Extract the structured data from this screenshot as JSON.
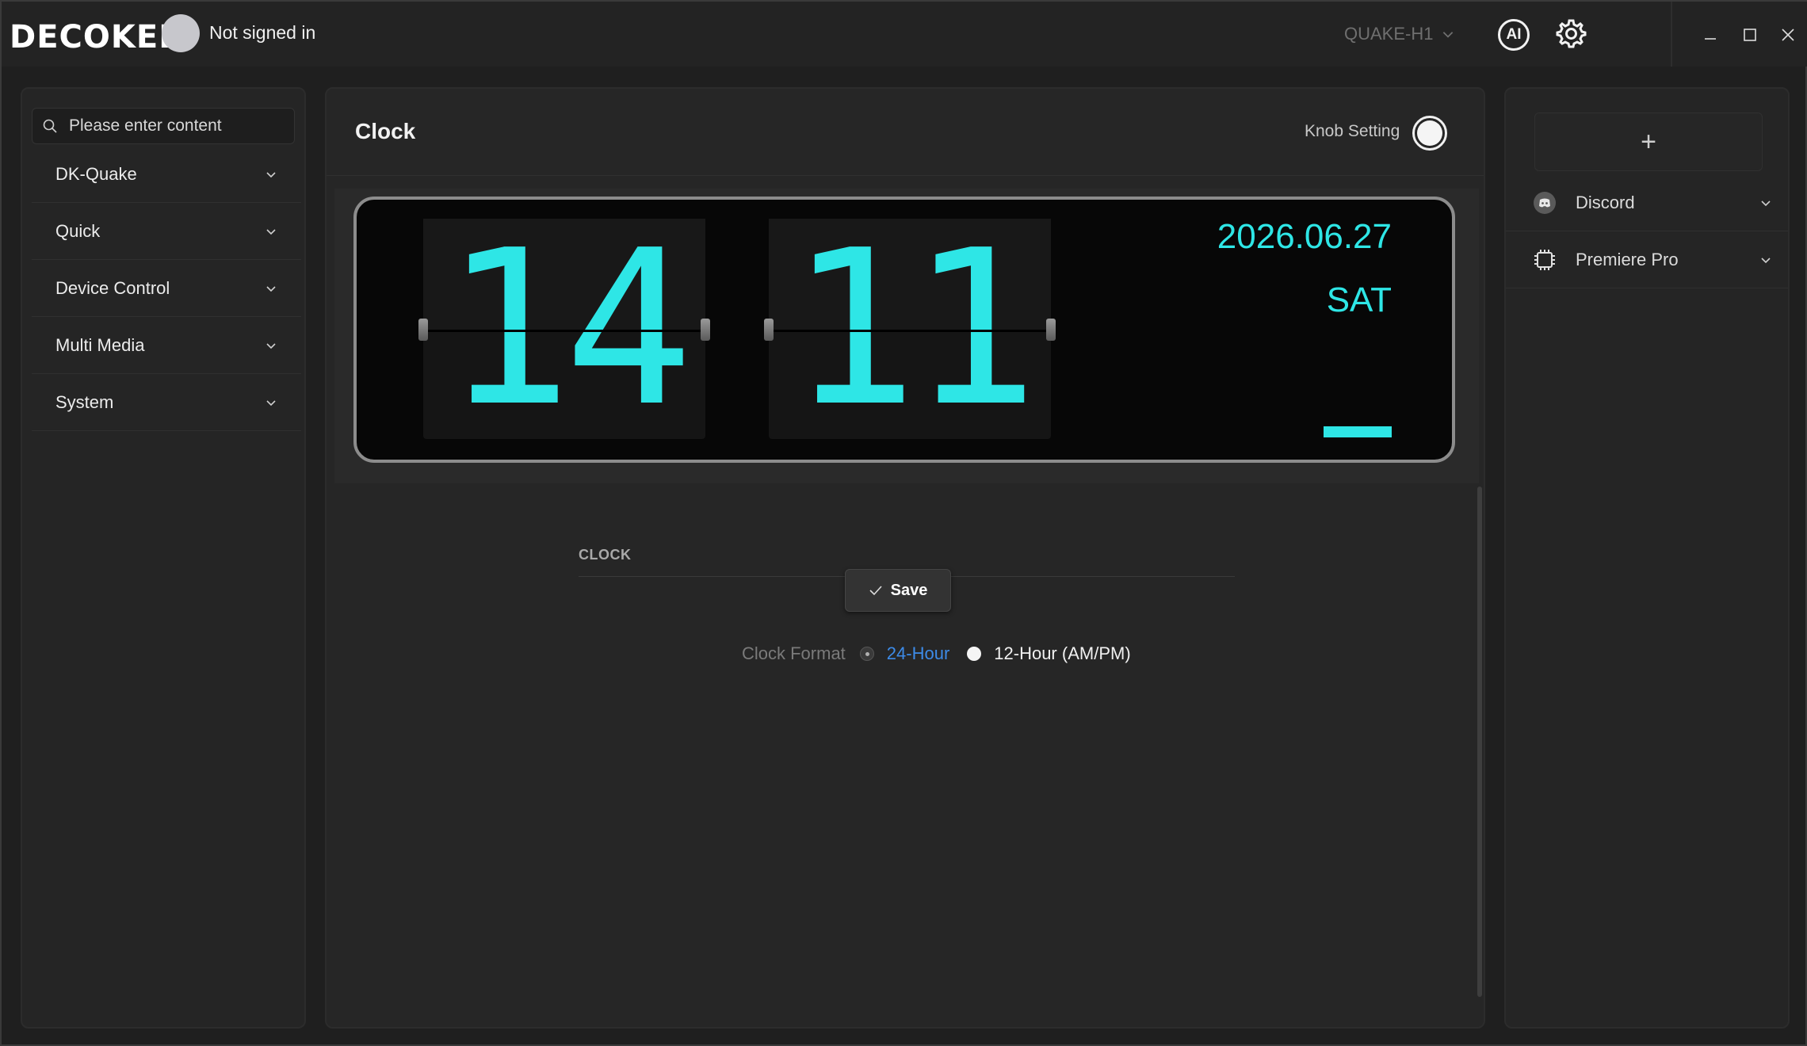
{
  "app": {
    "logo_text": "DECOKEE",
    "signin_text": "Not signed in",
    "device": "QUAKE-H1",
    "ai_label": "AI"
  },
  "sidebar": {
    "search_placeholder": "Please enter content",
    "items": [
      {
        "label": "DK-Quake"
      },
      {
        "label": "Quick"
      },
      {
        "label": "Device Control"
      },
      {
        "label": "Multi Media"
      },
      {
        "label": "System"
      }
    ]
  },
  "main": {
    "title": "Clock",
    "knob_setting_label": "Knob Setting",
    "knob_enabled": true,
    "clock": {
      "hours": "14",
      "minutes": "11",
      "date": "2026.06.27",
      "day": "SAT"
    },
    "section_label": "CLOCK",
    "save_label": "Save",
    "format_label": "Clock Format",
    "format_options": [
      {
        "label": "24-Hour",
        "selected": true
      },
      {
        "label": "12-Hour (AM/PM)",
        "selected": false
      }
    ]
  },
  "right_panel": {
    "add_label": "+",
    "apps": [
      {
        "label": "Discord",
        "icon": "discord-icon"
      },
      {
        "label": "Premiere Pro",
        "icon": "chip-icon"
      }
    ]
  },
  "colors": {
    "accent_cyan": "#2ee6e6",
    "link_blue": "#3d8be8",
    "background": "#1f1f1f"
  }
}
